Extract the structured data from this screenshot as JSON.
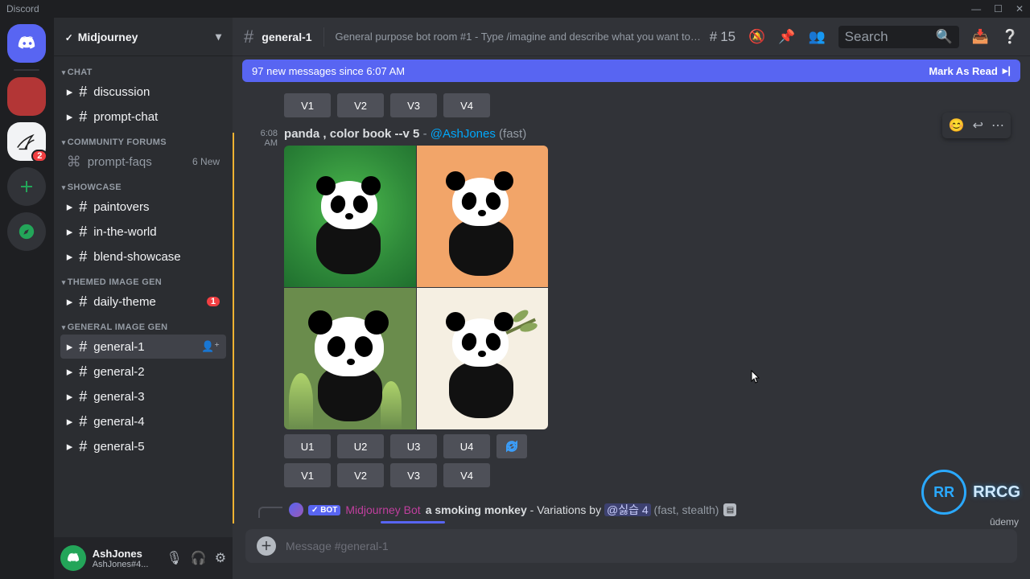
{
  "titlebar": {
    "app_name": "Discord",
    "minimize": "—",
    "maximize": "☐",
    "close": "✕"
  },
  "rail": {
    "dm_badge": "2"
  },
  "server": {
    "name": "Midjourney"
  },
  "categories": [
    {
      "label": "CHAT"
    },
    {
      "label": "COMMUNITY FORUMS"
    },
    {
      "label": "SHOWCASE"
    },
    {
      "label": "THEMED IMAGE GEN"
    },
    {
      "label": "GENERAL IMAGE GEN"
    }
  ],
  "channels": {
    "discussion": "discussion",
    "prompt_chat": "prompt-chat",
    "prompt_faqs": "prompt-faqs",
    "prompt_faqs_new": "6 New",
    "paintovers": "paintovers",
    "in_the_world": "in-the-world",
    "blend_showcase": "blend-showcase",
    "daily_theme": "daily-theme",
    "daily_theme_badge": "1",
    "general_1": "general-1",
    "general_2": "general-2",
    "general_3": "general-3",
    "general_4": "general-4",
    "general_5": "general-5"
  },
  "user": {
    "name": "AshJones",
    "tag": "AshJones#4..."
  },
  "header": {
    "channel": "general-1",
    "topic": "General purpose bot room #1 - Type /imagine and describe what you want to d...",
    "thread_count": "15",
    "search_placeholder": "Search"
  },
  "banner": {
    "left": "97 new messages since 6:07 AM",
    "right": "Mark As Read"
  },
  "msg": {
    "ts": "6:08 AM",
    "prompt": "panda , color book --v 5",
    "dash": "-",
    "user": "@AshJones",
    "mode": "(fast)"
  },
  "buttons_v": {
    "v1": "V1",
    "v2": "V2",
    "v3": "V3",
    "v4": "V4"
  },
  "buttons_u": {
    "u1": "U1",
    "u2": "U2",
    "u3": "U3",
    "u4": "U4"
  },
  "reply": {
    "bot_tag": "✓ BOT",
    "bot_name": "Midjourney Bot",
    "prompt": "a smoking monkey",
    "dash": " - ",
    "variations_by": "Variations by ",
    "mention": "@싫습 4",
    "mode": " (fast, stealth) "
  },
  "composer": {
    "placeholder": "Message #general-1"
  },
  "watermark": {
    "badge": "RR",
    "text": "RRCG",
    "udemy": "ûdemy"
  }
}
